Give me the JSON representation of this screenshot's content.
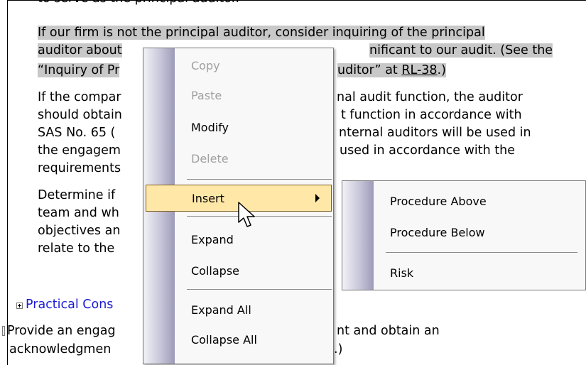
{
  "document": {
    "cut_line": "to serve as the principal auditor.",
    "p1": {
      "line1": "If our firm is not the principal auditor, consider inquiring of the principal",
      "line2a": "auditor about",
      "line2b": "nificant to our audit. (See the",
      "line3a": "“Inquiry of Pr",
      "line3b": "uditor” at",
      "line3_link": "RL-38",
      "line3_end": ".)"
    },
    "p2": {
      "line1a": "If the compar",
      "line1b": "nal audit function, the auditor",
      "line2a": "should obtain",
      "line2b": "t function in accordance with",
      "line3a": "SAS No. 65 (",
      "line3b": "nternal auditors will be used in",
      "line4a": "the engagem",
      "line4b": "used in accordance with the",
      "line5a": "requirements"
    },
    "p3": {
      "line1a": "Determine if",
      "line2a": "team and wh",
      "line3a": "objectives an",
      "line4a": "relate to the"
    },
    "practical_link": "Practical Cons",
    "p4": {
      "line1a": "Provide an engag",
      "line1b": "nt and obtain an",
      "line2a": "acknowledgmen",
      "line2_end": ".)"
    }
  },
  "context_menu": {
    "items": [
      {
        "label": "Copy",
        "enabled": false
      },
      {
        "label": "Paste",
        "enabled": false
      },
      {
        "label": "Modify",
        "enabled": true
      },
      {
        "label": "Delete",
        "enabled": false
      },
      {
        "label": "Insert",
        "enabled": true,
        "highlighted": true,
        "has_submenu": true
      },
      {
        "label": "Expand",
        "enabled": true
      },
      {
        "label": "Collapse",
        "enabled": true
      },
      {
        "label": "Expand All",
        "enabled": true
      },
      {
        "label": "Collapse All",
        "enabled": true
      }
    ]
  },
  "submenu": {
    "items": [
      {
        "label": "Procedure Above"
      },
      {
        "label": "Procedure Below"
      },
      {
        "label": "Risk"
      }
    ]
  },
  "colors": {
    "selection": "#c8c8c8",
    "highlight": "#ffe7a8",
    "link": "#1b1bd8"
  },
  "icons": [
    "expand-plus-icon",
    "submenu-arrow-icon",
    "mouse-cursor-icon"
  ]
}
